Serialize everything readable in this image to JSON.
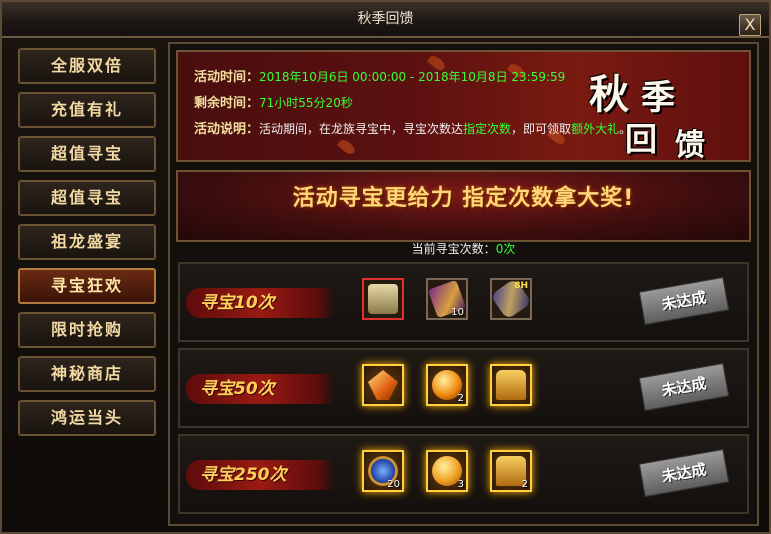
{
  "window": {
    "title": "秋季回馈",
    "close_label": "X"
  },
  "sidebar": {
    "items": [
      {
        "label": "全服双倍",
        "active": false
      },
      {
        "label": "充值有礼",
        "active": false
      },
      {
        "label": "超值寻宝",
        "active": false
      },
      {
        "label": "超值寻宝",
        "active": false
      },
      {
        "label": "祖龙盛宴",
        "active": false
      },
      {
        "label": "寻宝狂欢",
        "active": true
      },
      {
        "label": "限时抢购",
        "active": false
      },
      {
        "label": "神秘商店",
        "active": false
      },
      {
        "label": "鸿运当头",
        "active": false
      }
    ]
  },
  "info": {
    "time_key": "活动时间：",
    "time_val": "2018年10月6日 00:00:00 - 2018年10月8日 23:59:59",
    "remain_key": "剩余时间：",
    "remain_val": "71小时55分20秒",
    "desc_key": "活动说明：",
    "desc_1": "活动期间，在龙族寻宝中，寻宝次数达",
    "desc_2": "指定次数",
    "desc_3": "，即可领取",
    "desc_4": "额外大礼",
    "desc_5": "。",
    "banner_chars": [
      "秋",
      "季",
      "回",
      "馈"
    ]
  },
  "header": {
    "slogan": "活动寻宝更给力 指定次数拿大奖!"
  },
  "count": {
    "label": "当前寻宝次数：",
    "value": "0次"
  },
  "tiers": [
    {
      "label": "寻宝10次",
      "status": "未达成",
      "items": [
        {
          "icon": "treasure-chest-icon",
          "qty": "",
          "badge": ""
        },
        {
          "icon": "purple-scroll-icon",
          "qty": "10",
          "badge": ""
        },
        {
          "icon": "rolled-scroll-icon",
          "qty": "",
          "badge": "8H"
        }
      ]
    },
    {
      "label": "寻宝50次",
      "status": "未达成",
      "items": [
        {
          "icon": "crystal-icon",
          "qty": "",
          "badge": ""
        },
        {
          "icon": "gold-orb-icon",
          "qty": "2",
          "badge": ""
        },
        {
          "icon": "golden-chest-icon",
          "qty": "",
          "badge": ""
        }
      ]
    },
    {
      "label": "寻宝250次",
      "status": "未达成",
      "items": [
        {
          "icon": "blue-emblem-icon",
          "qty": "20",
          "badge": ""
        },
        {
          "icon": "gold-coin-icon",
          "qty": "3",
          "badge": ""
        },
        {
          "icon": "golden-chest-icon",
          "qty": "2",
          "badge": ""
        }
      ]
    }
  ],
  "colors": {
    "highlight_green": "#39ff39",
    "gold": "#ffd040",
    "title_cream": "#f3df9e"
  }
}
